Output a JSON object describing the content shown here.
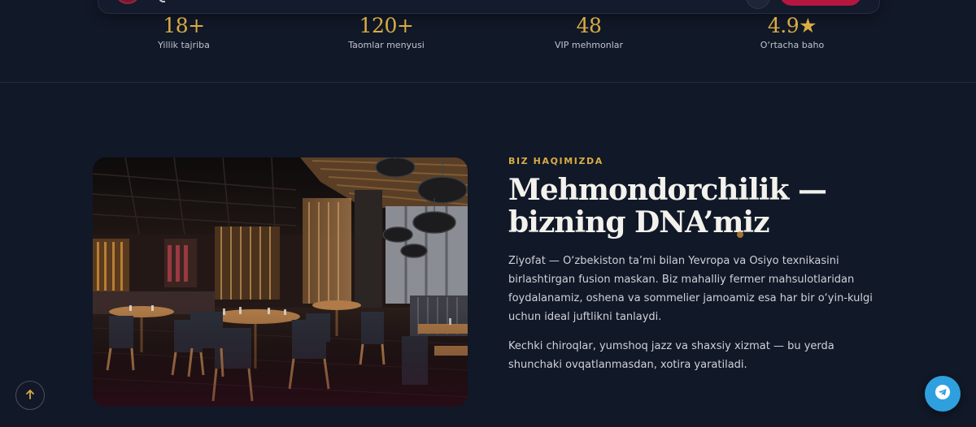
{
  "stats": [
    {
      "value": "18+",
      "label": "Yillik tajriba"
    },
    {
      "value": "120+",
      "label": "Taomlar menyusi"
    },
    {
      "value": "48",
      "label": "VIP mehmonlar"
    },
    {
      "value": "4.9★",
      "label": "O‘rtacha baho"
    }
  ],
  "about": {
    "eyebrow": "BIZ HAQIMIZDA",
    "title_line1": "Mehmondorchilik —",
    "title_line2": "bizning DNA’miz",
    "paragraph1": "Ziyofat — O‘zbekiston ta’mi bilan Yevropa va Osiyo texnikasini birlashtirgan fusion maskan. Biz mahalliy fermer mahsulotlaridan foydalanamiz, oshena va sommelier jamoamiz esa har bir o‘yin-kulgi uchun ideal juftlikni tanlaydi.",
    "paragraph2": "Kechki chiroqlar, yumshoq jazz va shaxsiy xizmat — bu yerda shunchaki ovqatlanmasdan, xotira yaratiladi."
  },
  "icons": {
    "back_to_top": "arrow-up-icon",
    "telegram": "telegram-icon",
    "star": "star-icon"
  },
  "colors": {
    "background": "#111827",
    "accent_gold": "#d9ab44",
    "brand_red": "#b5163f",
    "telegram_blue": "#2ea0df"
  }
}
